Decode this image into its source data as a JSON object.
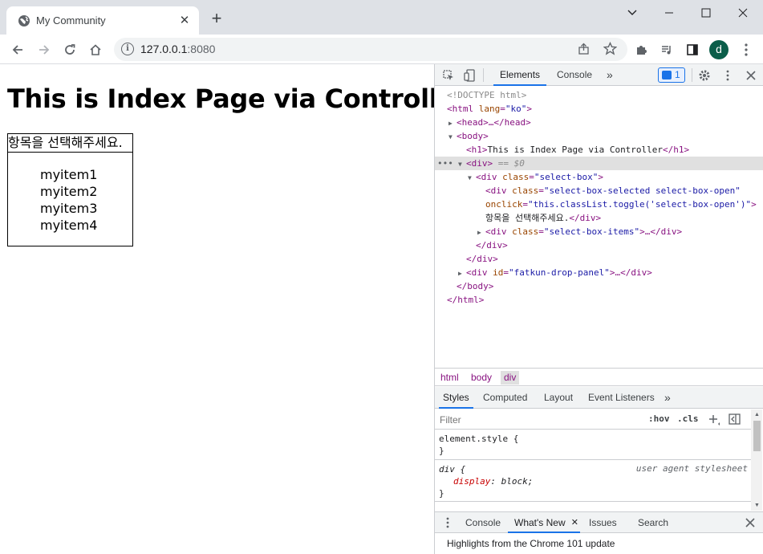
{
  "browser": {
    "tab_title": "My Community",
    "tab_close": "✕",
    "new_tab": "+",
    "url_host": "127.0.0.1",
    "url_port": ":8080",
    "profile_initial": "d"
  },
  "page": {
    "heading": "This is Index Page via Controller",
    "select_label": "항목을 선택해주세요.",
    "items": [
      "myitem1",
      "myitem2",
      "myitem3",
      "myitem4"
    ]
  },
  "devtools": {
    "tabs": [
      "Elements",
      "Console"
    ],
    "more_tabs": "»",
    "message_count": "1",
    "dom": {
      "doctype": "<!DOCTYPE html>",
      "html_open_tag": "<html",
      "html_lang_attr": " lang",
      "html_lang_val": "\"ko\"",
      "head": "<head>…</head>",
      "body_open": "<body>",
      "h1_open": "<h1>",
      "h1_text": "This is Index Page via Controller",
      "h1_close": "</h1>",
      "div_open": "<div>",
      "div_marker": "== $0",
      "selectbox_tag": "<div",
      "selectbox_attr": " class",
      "selectbox_val": "\"select-box\"",
      "selected_tag": "<div",
      "selected_attr": " class",
      "selected_val": "\"select-box-selected select-box-open\"",
      "onclick_attr": "onclick",
      "onclick_val": "\"this.classList.toggle('select-box-open')\"",
      "selected_text": "항목을 선택해주세요.",
      "div_close": "</div>",
      "items_tag": "<div",
      "items_attr": " class",
      "items_val": "\"select-box-items\"",
      "items_rest": ">…</div>",
      "drop_tag": "<div",
      "drop_attr": " id",
      "drop_val": "\"fatkun-drop-panel\"",
      "drop_rest": ">…</div>",
      "body_close": "</body>",
      "html_close": "</html>"
    },
    "breadcrumbs": [
      "html",
      "body",
      "div"
    ],
    "styles_tabs": [
      "Styles",
      "Computed",
      "Layout",
      "Event Listeners"
    ],
    "filter_placeholder": "Filter",
    "hov": ":hov",
    "cls": ".cls",
    "rules": {
      "element_style": "element.style {",
      "close_brace": "}",
      "div_selector": "div {",
      "div_origin": "user agent stylesheet",
      "div_prop": "display",
      "div_value": "block;"
    },
    "drawer_tabs": [
      "Console",
      "What's New",
      "Issues",
      "Search"
    ],
    "drawer_message": "Highlights from the Chrome 101 update"
  }
}
